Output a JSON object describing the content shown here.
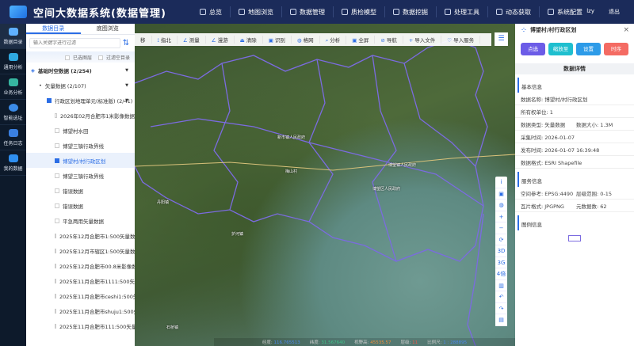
{
  "header": {
    "title": "空间大数据系统(数据管理)",
    "nav": [
      "总览",
      "地图浏览",
      "数据管理",
      "质检模型",
      "数据挖掘",
      "处理工具",
      "动态获取",
      "系统配置"
    ],
    "user": "lzy",
    "logout": "退出"
  },
  "leftbar": [
    "数据目录",
    "通用分析",
    "业务分析",
    "智能选址",
    "任务日志",
    "我的数据"
  ],
  "panel": {
    "tabs": [
      "数据目录",
      "底图浏览"
    ],
    "search_placeholder": "输入关键字进行过滤",
    "filters": [
      "已选图层",
      "过滤空目录"
    ],
    "tree": [
      {
        "label": "基础时空数据 (2/254)",
        "level": 0
      },
      {
        "label": "矢量数据 (2/107)",
        "level": 1
      },
      {
        "label": "行政区划地理单元(标准版) (2/41)",
        "level": 2,
        "checked": true
      },
      {
        "label": "2026年02月合肥市1米影像数据",
        "level": 3
      },
      {
        "label": "博望村水田",
        "level": 3
      },
      {
        "label": "博望三镇行政界线",
        "level": 3
      },
      {
        "label": "博望村/村行政区划",
        "level": 3,
        "checked": true,
        "selected": true
      },
      {
        "label": "博望三镇行政界线",
        "level": 3
      },
      {
        "label": "错误数据",
        "level": 3
      },
      {
        "label": "错误数据",
        "level": 3
      },
      {
        "label": "平急两用矢量数据",
        "level": 3
      },
      {
        "label": "2025年12月合肥市1:500矢量数据",
        "level": 3
      },
      {
        "label": "2025年12月市辖区1:500矢量数据",
        "level": 3
      },
      {
        "label": "2025年12月合肥市00.8米影像数据",
        "level": 3
      },
      {
        "label": "2025年11月合肥市1111:500矢量...",
        "level": 3
      },
      {
        "label": "2025年11月合肥市ceshi1:500矢...",
        "level": 3
      },
      {
        "label": "2025年11月合肥市shuju1:500矢...",
        "level": 3
      },
      {
        "label": "2025年11月合肥市111:500矢量...",
        "level": 3
      }
    ]
  },
  "toolbar": [
    "移",
    "指北",
    "测量",
    "漫游",
    "清除",
    "识别",
    "格网",
    "分析",
    "全屏",
    "导航",
    "导入文件",
    "导入服务"
  ],
  "mapcontrols": [
    "i",
    "▣",
    "◍",
    "+",
    "−",
    "⟳",
    "3D",
    "3G",
    "4倍",
    "▥",
    "↶",
    "↷",
    "▤"
  ],
  "map_labels": [
    "新市镇人民政府",
    "博望区人民政府",
    "博望镇人民政府",
    "梅山村",
    "丹阳镇",
    "石桥镇",
    "护河镇"
  ],
  "status": {
    "lon_label": "经度:",
    "lon": "116.765513",
    "lat_label": "纬度:",
    "lat": "31.567640",
    "alt_label": "视野高:",
    "alt": "45535.57",
    "level_label": "层级:",
    "level": "11",
    "scale_label": "比例尺:",
    "scale": "1 : 288895"
  },
  "right": {
    "title": "博望村/村行政区划",
    "buttons": [
      "点选",
      "缩放至",
      "设置",
      "时序"
    ],
    "detail_title": "数据详情",
    "basic_title": "基本信息",
    "name": "数据名称: 博望村/村行政区划",
    "owner": "所有权单位: 1",
    "type": "数据类型: 矢量数据",
    "size": "数据大小: 1.3M",
    "collect": "采集时间: 2026-01-07",
    "publish": "发布时间: 2026-01-07 16:39:48",
    "format": "数据格式: ESRI Shapefile",
    "service_title": "服务信息",
    "srs": "空间参考: EPSG:4490",
    "levels": "层级范围: 0-15",
    "tile": "瓦片格式: JPGPNG",
    "meta": "元数据数: 62",
    "legend_title": "图例信息"
  },
  "colors": {
    "header": "#1b2b5a",
    "accent": "#2b6de5",
    "boundary": "#7b6be0"
  }
}
